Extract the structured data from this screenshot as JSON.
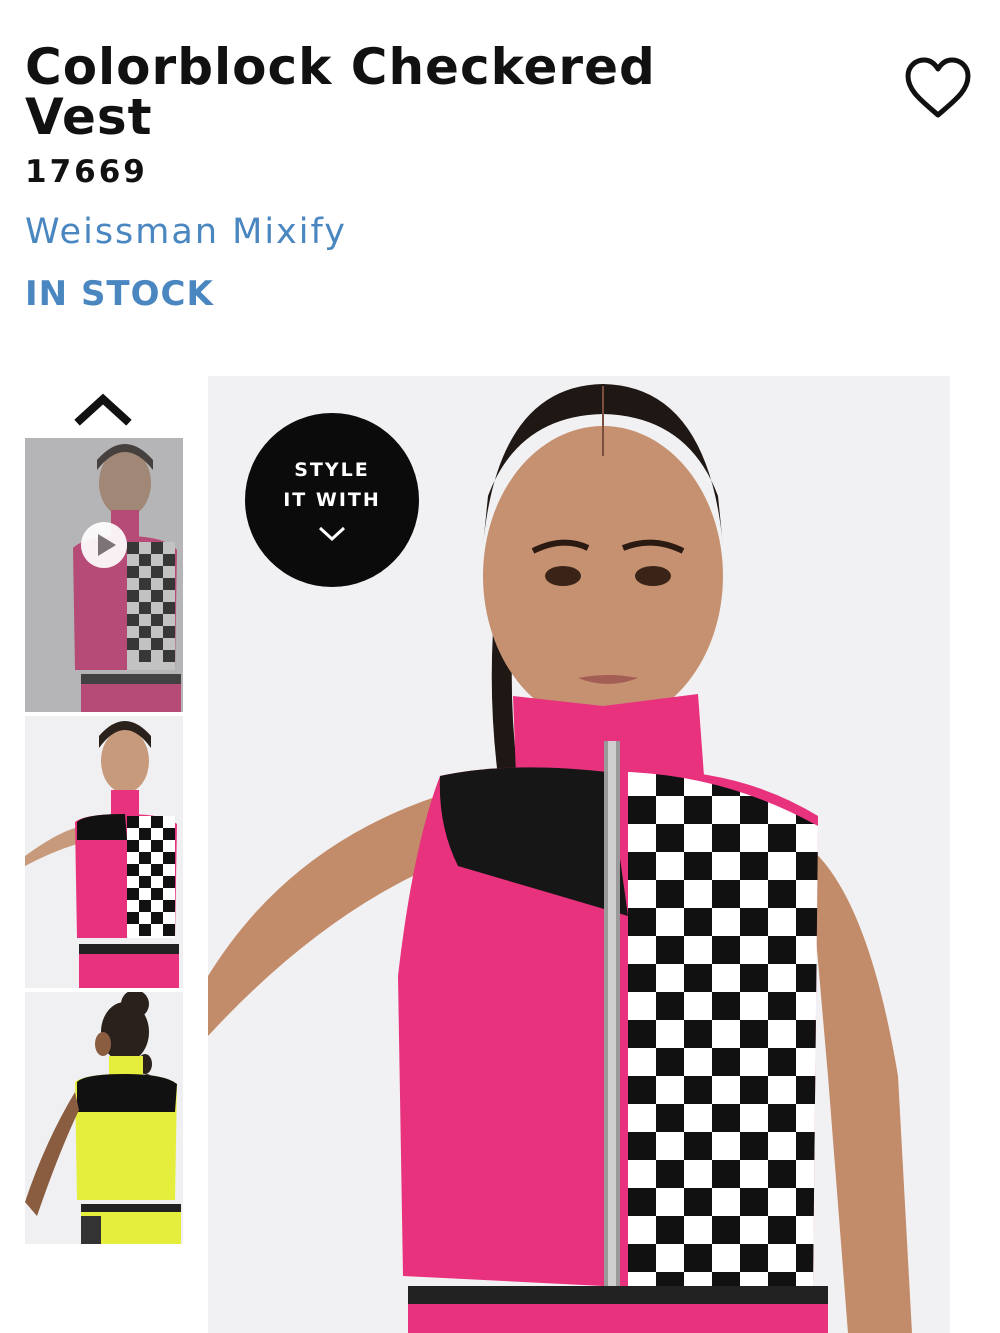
{
  "product": {
    "title": "Colorblock Checkered Vest",
    "sku": "17669",
    "brand": "Weissman Mixify",
    "stock_status": "IN STOCK"
  },
  "gallery": {
    "style_button": {
      "line1": "STYLE",
      "line2": "IT WITH"
    },
    "thumbnails": [
      {
        "label": "pink vest front video",
        "selected": true,
        "has_video": true
      },
      {
        "label": "pink vest front"
      },
      {
        "label": "yellow vest back"
      }
    ]
  },
  "icons": {
    "favorite": "heart-icon",
    "scroll_up": "chevron-up-icon",
    "play": "play-icon",
    "style_chevron": "chevron-down-icon"
  },
  "colors": {
    "accent": "#4a86c0",
    "title": "#111111",
    "pink": "#e8327d",
    "yellow": "#e5ee3c"
  }
}
